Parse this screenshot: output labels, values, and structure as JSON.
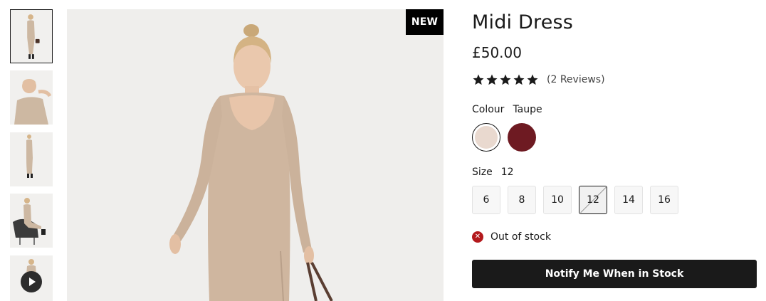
{
  "gallery": {
    "badge": "NEW",
    "thumbnails": [
      {
        "icon": "model-full-length-image",
        "active": true
      },
      {
        "icon": "model-closeup-image"
      },
      {
        "icon": "model-full-length-image"
      },
      {
        "icon": "model-seated-image"
      },
      {
        "icon": "video-play-icon",
        "video": true
      }
    ]
  },
  "product": {
    "title": "Midi Dress",
    "price": "£50.00",
    "rating_value": 5,
    "rating_max": 5,
    "reviews_label": "(2 Reviews)"
  },
  "colour": {
    "label": "Colour",
    "selected": "Taupe",
    "swatches": [
      {
        "name": "taupe",
        "color": "#e9d9cf",
        "selected": true
      },
      {
        "name": "burgundy",
        "color": "#6e1a22"
      }
    ]
  },
  "size": {
    "label": "Size",
    "selected": "12",
    "options": [
      "6",
      "8",
      "10",
      "12",
      "14",
      "16"
    ]
  },
  "stock": {
    "icon": "close-icon",
    "text": "Out of stock",
    "status_color": "#b3191c"
  },
  "cta": {
    "label": "Notify Me When in Stock",
    "color": "#1a1a1a"
  }
}
